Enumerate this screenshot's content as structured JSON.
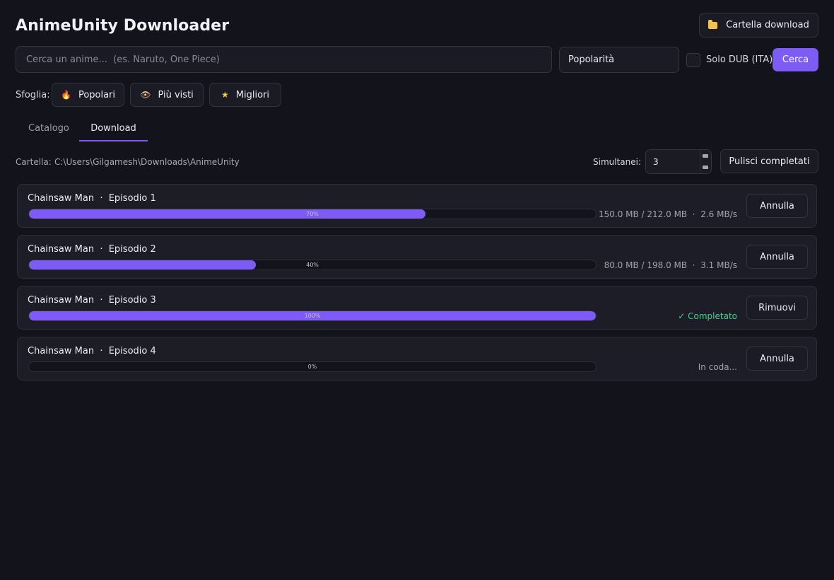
{
  "header": {
    "title": "AnimeUnity Downloader",
    "folder_button_label": "Cartella download",
    "folder_icon": "folder-icon"
  },
  "search": {
    "placeholder": "Cerca un anime...  (es. Naruto, One Piece)",
    "value": "",
    "sort_selected": "Popolarità",
    "dub_only_label": "Solo DUB (ITA)",
    "dub_only_checked": false,
    "search_button_label": "Cerca"
  },
  "browse": {
    "label": "Sfoglia:",
    "buttons": [
      {
        "label": "Popolari",
        "icon": "fire-icon"
      },
      {
        "label": "Più visti",
        "icon": "eye-icon"
      },
      {
        "label": "Migliori",
        "icon": "star-icon"
      }
    ]
  },
  "tabs": [
    {
      "label": "Catalogo",
      "active": false
    },
    {
      "label": "Download",
      "active": true
    }
  ],
  "download_panel": {
    "folder_label": "Cartella:",
    "folder_path": "C:\\Users\\Gilgamesh\\Downloads\\AnimeUnity",
    "concurrent_label": "Simultanei:",
    "concurrent_value": "3",
    "clear_button_label": "Pulisci completati"
  },
  "downloads": [
    {
      "title": "Chainsaw Man  ·  Episodio 1",
      "progress": 70,
      "progress_label": "70%",
      "stats": "150.0 MB / 212.0 MB  ·  2.6 MB/s",
      "status": "downloading",
      "action_label": "Annulla"
    },
    {
      "title": "Chainsaw Man  ·  Episodio 2",
      "progress": 40,
      "progress_label": "40%",
      "stats": "80.0 MB / 198.0 MB  ·  3.1 MB/s",
      "status": "downloading",
      "action_label": "Annulla"
    },
    {
      "title": "Chainsaw Man  ·  Episodio 3",
      "progress": 100,
      "progress_label": "100%",
      "stats": "✓ Completato",
      "status": "completed",
      "action_label": "Rimuovi"
    },
    {
      "title": "Chainsaw Man  ·  Episodio 4",
      "progress": 0,
      "progress_label": "0%",
      "stats": "In coda...",
      "status": "queued",
      "action_label": "Annulla"
    }
  ],
  "colors": {
    "accent": "#7d5cf5",
    "background": "#13131b",
    "card": "#1d1d28",
    "completed": "#4ccf84"
  }
}
